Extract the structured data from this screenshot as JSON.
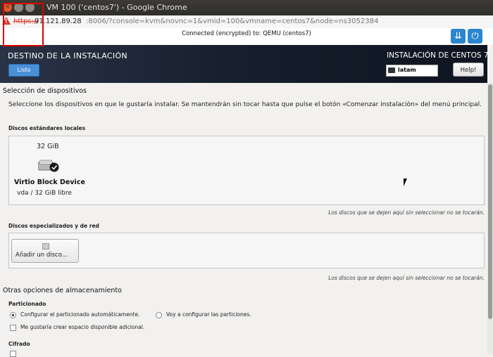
{
  "browser": {
    "window_title": "VM 100 ('centos7') - Google Chrome",
    "url_scheme": "https://",
    "url_host": "91.121.89.28",
    "url_rest": ":8006/?console=kvm&novnc=1&vmid=100&vmname=centos7&node=ns3052384"
  },
  "vnc": {
    "status": "Connected (encrypted) to: QEMU (centos7)"
  },
  "header": {
    "title": "DESTINO DE LA INSTALACIÓN",
    "done_label": "Listo",
    "product": "INSTALACIÓN DE CENTOS 7",
    "keyboard_layout": "latam",
    "help_label": "Help!"
  },
  "devices": {
    "section_title": "Selección de dispositivos",
    "intro": "Seleccione los dispositivos en que le gustaría instalar. Se mantendrán sin tocar hasta que pulse el botón «Comenzar instalación» del menú principal.",
    "local_title": "Discos estándares locales",
    "disk": {
      "size": "32 GiB",
      "name": "Virtio Block Device",
      "free": "vda  /  32 GiB libre"
    },
    "local_note": "Los discos que se dejen aquí sin seleccionar no se tocarán.",
    "special_title": "Discos especializados y de red",
    "add_disk_label": "Añadir un disco...",
    "special_note": "Los discos que se dejen aquí sin seleccionar no se tocarán."
  },
  "storage": {
    "section_title": "Otras opciones de almacenamiento",
    "partitioning_title": "Particionado",
    "auto_label": "Configurar el particionado automáticamente.",
    "manual_label": "Voy a configurar las particiones.",
    "extra_space_label": "Me gustaría crear espacio disponible adicional.",
    "cipher_title": "Cifrado"
  }
}
